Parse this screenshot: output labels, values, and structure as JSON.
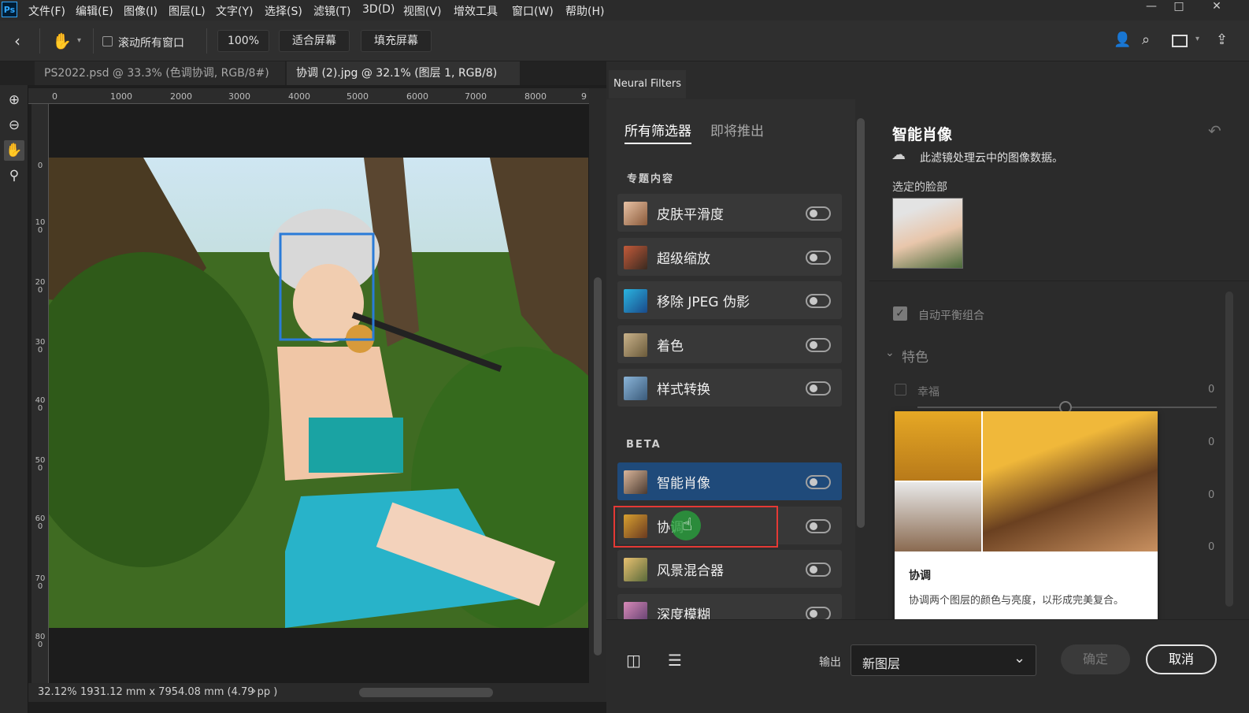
{
  "app": {
    "logo": "Ps"
  },
  "menu": [
    "文件(F)",
    "编辑(E)",
    "图像(I)",
    "图层(L)",
    "文字(Y)",
    "选择(S)",
    "滤镜(T)",
    "3D(D)",
    "视图(V)",
    "增效工具",
    "窗口(W)",
    "帮助(H)"
  ],
  "window_controls": {
    "minimize": "—",
    "maximize": "□",
    "close": "✕"
  },
  "options": {
    "scroll_all_windows": "滚动所有窗口",
    "zoom_value": "100%",
    "fit_screen": "适合屏幕",
    "fill_screen": "填充屏幕"
  },
  "tabs": [
    {
      "label": "PS2022.psd @ 33.3% (色调协调, RGB/8#) *",
      "active": false
    },
    {
      "label": "协调 (2).jpg @ 32.1% (图层 1, RGB/8) *",
      "active": true
    }
  ],
  "tab_close": "×",
  "ruler": {
    "h": [
      "0",
      "1000",
      "2000",
      "3000",
      "4000",
      "5000",
      "6000",
      "7000",
      "8000",
      "9"
    ],
    "v": [
      "0",
      "100",
      "200",
      "300",
      "400",
      "500",
      "600",
      "700",
      "800"
    ]
  },
  "status": {
    "zoom": "32.12%",
    "size": "1931.12 mm x 7954.08 mm (4.79 pp )",
    "arrow": "›"
  },
  "neural": {
    "tab": "Neural Filters",
    "subtabs": [
      "所有筛选器",
      "即将推出"
    ],
    "featured_title": "专题内容",
    "beta_title": "BETA",
    "featured": [
      {
        "label": "皮肤平滑度"
      },
      {
        "label": "超级缩放"
      },
      {
        "label": "移除 JPEG 伪影"
      },
      {
        "label": "着色"
      },
      {
        "label": "样式转换"
      }
    ],
    "beta": [
      {
        "label": "智能肖像",
        "selected": true
      },
      {
        "label": "协调",
        "selected": false
      },
      {
        "label": "风景混合器",
        "selected": false
      },
      {
        "label": "深度模糊",
        "selected": false
      }
    ],
    "right": {
      "title": "智能肖像",
      "cloud_note": "此滤镜处理云中的图像数据。",
      "selected_face": "选定的脸部",
      "auto_balance": "自动平衡组合",
      "features": "特色",
      "happiness": "幸福",
      "values": [
        "0",
        "0",
        "0",
        "0"
      ]
    },
    "tooltip": {
      "title": "协调",
      "desc": "协调两个图层的颜色与亮度，以形成完美复合。"
    },
    "bottom": {
      "output_label": "输出",
      "output_value": "新图层",
      "ok": "确定",
      "cancel": "取消"
    }
  },
  "colors": {
    "accent": "#1f4a7a",
    "highlight_red": "#e53935",
    "face_box": "#2a7bd8"
  }
}
